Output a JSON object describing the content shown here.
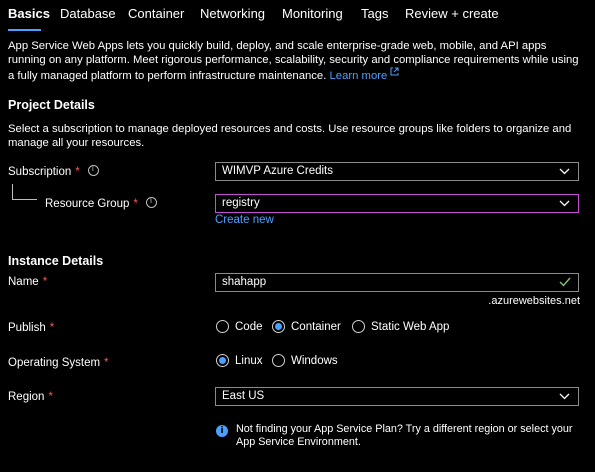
{
  "tabs": [
    {
      "label": "Basics",
      "active": true
    },
    {
      "label": "Database"
    },
    {
      "label": "Container"
    },
    {
      "label": "Networking"
    },
    {
      "label": "Monitoring"
    },
    {
      "label": "Tags"
    },
    {
      "label": "Review + create"
    }
  ],
  "intro": {
    "text": "App Service Web Apps lets you quickly build, deploy, and scale enterprise-grade web, mobile, and API apps running on any platform. Meet rigorous performance, scalability, security and compliance requirements while using a fully managed platform to perform infrastructure maintenance.",
    "learn_more": "Learn more"
  },
  "project": {
    "title": "Project Details",
    "description": "Select a subscription to manage deployed resources and costs. Use resource groups like folders to organize and manage all your resources.",
    "subscription_label": "Subscription",
    "subscription_value": "WIMVP Azure Credits",
    "resource_group_label": "Resource Group",
    "resource_group_value": "registry",
    "create_new": "Create new"
  },
  "instance": {
    "title": "Instance Details",
    "name_label": "Name",
    "name_value": "shahapp",
    "name_suffix": ".azurewebsites.net",
    "publish_label": "Publish",
    "publish_options": [
      "Code",
      "Container",
      "Static Web App"
    ],
    "publish_selected": "Container",
    "os_label": "Operating System",
    "os_options": [
      "Linux",
      "Windows"
    ],
    "os_selected": "Linux",
    "region_label": "Region",
    "region_value": "East US",
    "region_note": "Not finding your App Service Plan? Try a different region or select your App Service Environment."
  },
  "required_mark": "*",
  "colors": {
    "accent": "#4aa0ff",
    "required": "#f25a5a",
    "focus_border": "#c44dd4",
    "valid_check": "#7cc47c"
  }
}
